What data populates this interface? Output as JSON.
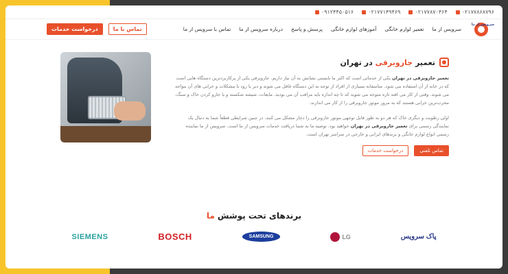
{
  "topbar": {
    "phones": [
      "۰۲۱۷۷۸۶۸۷۹۶",
      "۰۲۱۷۷۸۷۰۴۶۴",
      "۰۲۱۷۷۱۴۹۴۶۹",
      "۰۹۱۲۴۴۵۰۵۱۶"
    ]
  },
  "nav": {
    "items": [
      "سرویس از ما",
      "تعمیر لوازم خانگی",
      "آموزهای لوازم خانگی",
      "پرسش و پاسخ",
      "درباره سرویس از ما",
      "تماس با سرویس از ما"
    ],
    "contact_button": "تماس با ما",
    "request_button": "درخواست خدمات",
    "logo_text": "سرویس از ما"
  },
  "main": {
    "title_prefix": "تعمیر ",
    "title_accent": "جاروبرقی",
    "title_suffix": " در تهران",
    "p1_bold": "تعمیر جاروبرقی در تهران",
    "p1": " یکی از خدماتی است که اکثر ما بایستی نشانش به آن نیاز داریم. جاروبرقی یکی از پرکاربردترین دستگاه هایی است که در خانه از آن استفاده می شود. متاسفانه بسیاری از افراد از توجه به این دستگاه غافل می شوند و دیر یا زود با مشکلات و خرابی های آن مواجه می شوند. وقتی از کار می افتد تازه متوجه می شوید که تا چه اندازه باید مراقب آن می بودید. مایعات، شیشه شکسته و یا جارو کردن خاک و سنگ، مخرب‌ترین خرابی هستند که به مرور موتور جاروبرقی را از کار می اندازند.",
    "p2_start": "اولی رطوبت و دیگری خاک که هر دو به طور قابل توجهی موتور جاروبرقی را دچار مشکل می کنند. در چنین شرایطی قطعاً شما به دنبال یک نمایندگی رسمی برای ",
    "p2_bold1": "تعمیر جاروبرقی در تهران",
    "p2_end": " خواهید بود. توصیه ما به شما دریافت خدمات سرویس از ما است. سرویس از ما نماینده رسمی انواع لوازم خانگی و برندهای ایرانی و خارجی در سراسر تهران است.",
    "call_button": "تماس تلفنی",
    "request_button": "درخواست خدمات"
  },
  "brands": {
    "title_prefix": "برندهای تحت پوشش ",
    "title_accent": "ما",
    "items": [
      "SIEMENS",
      "BOSCH",
      "SAMSUNG",
      "LG",
      "پاک سرویس"
    ]
  },
  "colors": {
    "accent": "#e8502b",
    "frame": "#f7c52b",
    "text": "#777777"
  }
}
